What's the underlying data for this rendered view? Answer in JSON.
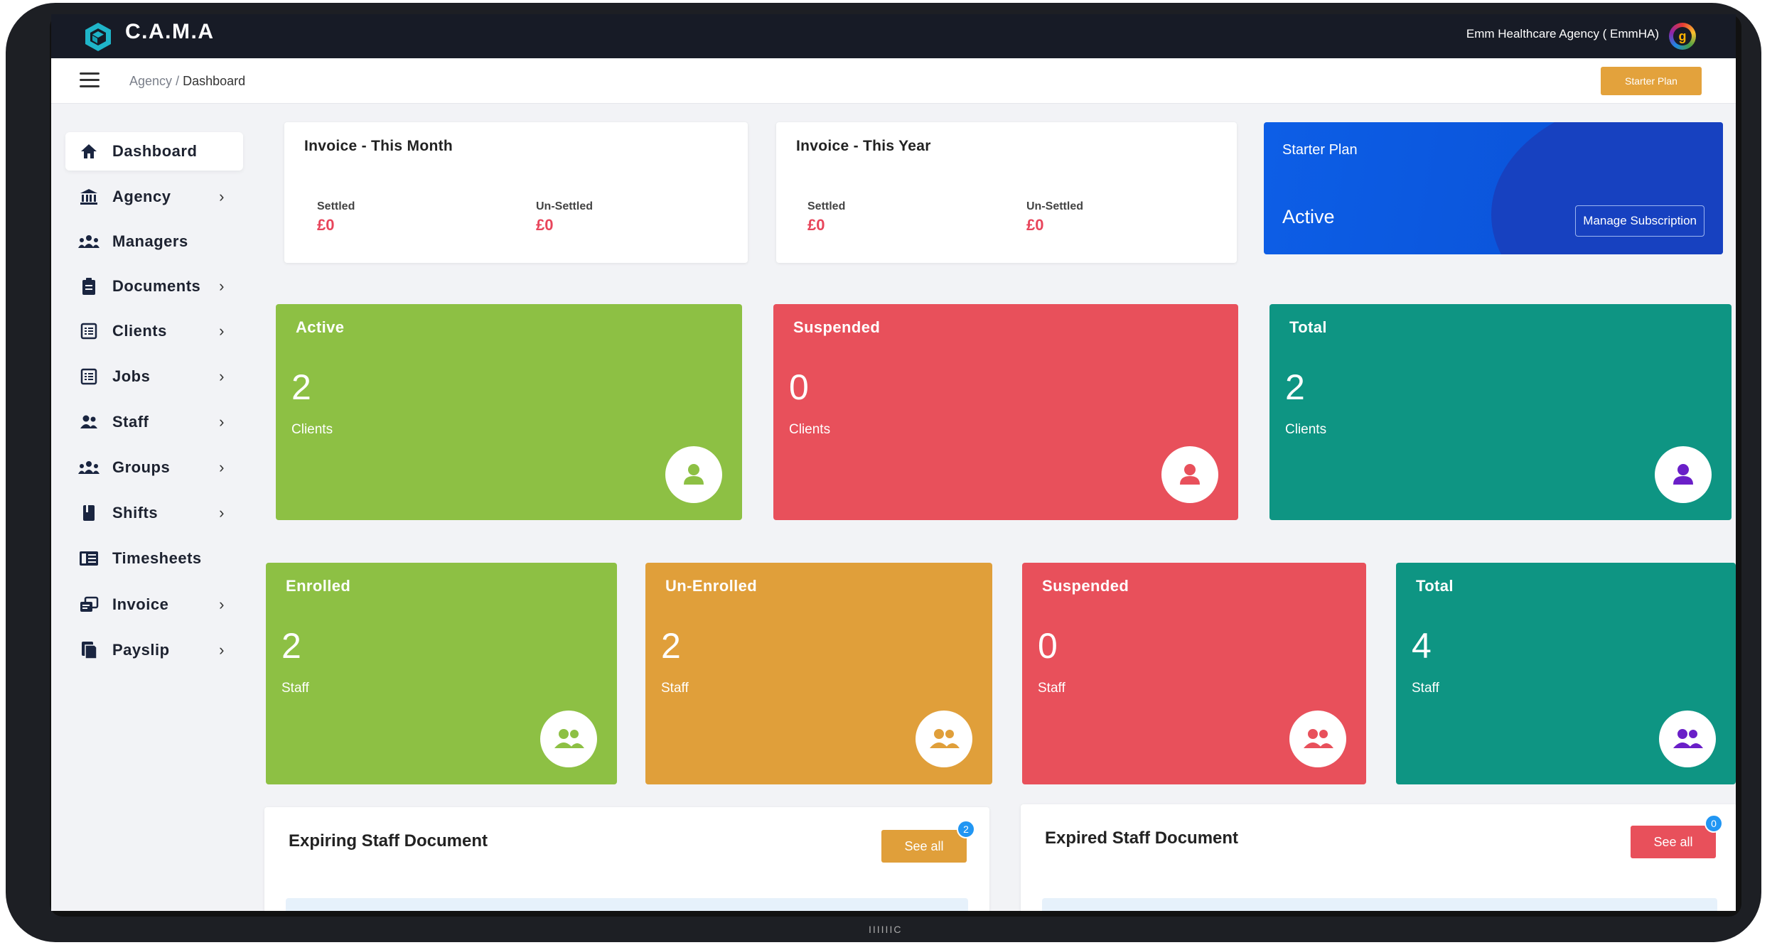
{
  "app": {
    "brand": "C.A.M.A",
    "agency_name": "Emm Healthcare Agency ( EmmHA)",
    "agency_logo_letter": "g"
  },
  "breadcrumb": {
    "parent": "Agency",
    "separator": "/",
    "current": "Dashboard"
  },
  "header": {
    "plan_button": "Starter Plan"
  },
  "sidebar": {
    "items": [
      {
        "label": "Dashboard",
        "icon": "home-icon",
        "active": true
      },
      {
        "label": "Agency",
        "icon": "bank-icon",
        "chevron": "›"
      },
      {
        "label": "Managers",
        "icon": "users-icon"
      },
      {
        "label": "Documents",
        "icon": "clipboard-icon",
        "chevron": "›"
      },
      {
        "label": "Clients",
        "icon": "list-icon",
        "chevron": "›"
      },
      {
        "label": "Jobs",
        "icon": "list-icon",
        "chevron": "›"
      },
      {
        "label": "Staff",
        "icon": "user-group-icon",
        "chevron": "›"
      },
      {
        "label": "Groups",
        "icon": "users-icon",
        "chevron": "›"
      },
      {
        "label": "Shifts",
        "icon": "book-icon",
        "chevron": "›"
      },
      {
        "label": "Timesheets",
        "icon": "timesheet-icon"
      },
      {
        "label": "Invoice",
        "icon": "invoice-icon",
        "chevron": "›"
      },
      {
        "label": "Payslip",
        "icon": "document-icon",
        "chevron": "›"
      }
    ]
  },
  "invoice_month": {
    "title": "Invoice - This Month",
    "settled_label": "Settled",
    "settled_value": "£0",
    "unsettled_label": "Un-Settled",
    "unsettled_value": "£0"
  },
  "invoice_year": {
    "title": "Invoice - This Year",
    "settled_label": "Settled",
    "settled_value": "£0",
    "unsettled_label": "Un-Settled",
    "unsettled_value": "£0"
  },
  "plan": {
    "title": "Starter Plan",
    "status": "Active",
    "manage_button": "Manage Subscription"
  },
  "client_stats": [
    {
      "title": "Active",
      "value": "2",
      "unit": "Clients",
      "color": "#8dc044",
      "icon_color": "#8dc044"
    },
    {
      "title": "Suspended",
      "value": "0",
      "unit": "Clients",
      "color": "#e8505b",
      "icon_color": "#e8505b"
    },
    {
      "title": "Total",
      "value": "2",
      "unit": "Clients",
      "color": "#0e9583",
      "icon_color": "#6a1fc8"
    }
  ],
  "staff_stats": [
    {
      "title": "Enrolled",
      "value": "2",
      "unit": "Staff",
      "color": "#8dc044",
      "icon_color": "#8dc044"
    },
    {
      "title": "Un-Enrolled",
      "value": "2",
      "unit": "Staff",
      "color": "#e09f3a",
      "icon_color": "#e09f3a"
    },
    {
      "title": "Suspended",
      "value": "0",
      "unit": "Staff",
      "color": "#e8505b",
      "icon_color": "#e8505b"
    },
    {
      "title": "Total",
      "value": "4",
      "unit": "Staff",
      "color": "#0e9583",
      "icon_color": "#6a1fc8"
    }
  ],
  "expiring_docs": {
    "title": "Expiring Staff Document",
    "button": "See all",
    "badge": "2",
    "button_color": "#e09f3a"
  },
  "expired_docs": {
    "title": "Expired Staff Document",
    "button": "See all",
    "badge": "0",
    "button_color": "#e8505b"
  },
  "device": {
    "chin_label": "IIIIIIC"
  }
}
